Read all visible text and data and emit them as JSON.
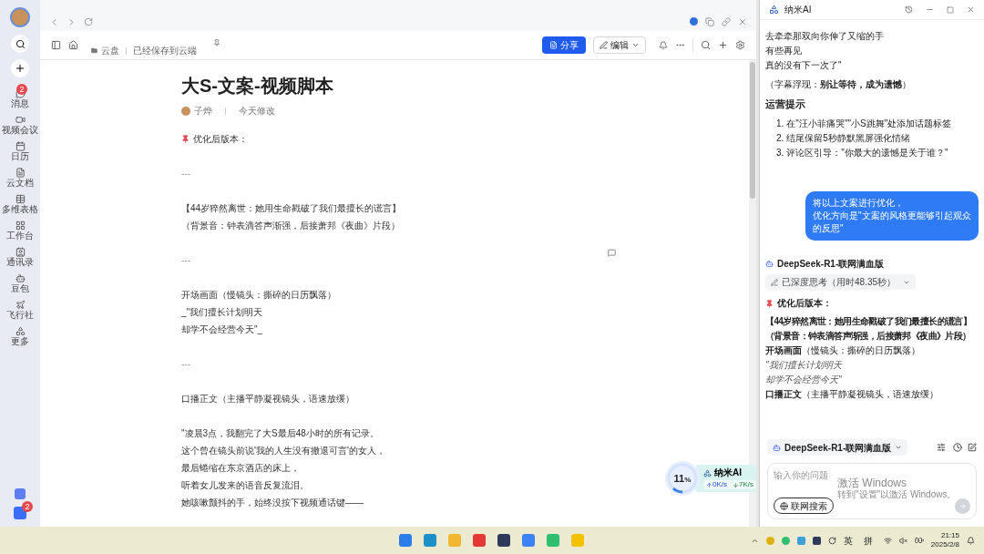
{
  "sidebar": {
    "items": [
      {
        "label": "消息",
        "badge": "2"
      },
      {
        "label": "视频会议"
      },
      {
        "label": "日历"
      },
      {
        "label": "云文档"
      },
      {
        "label": "多维表格"
      },
      {
        "label": "工作台"
      },
      {
        "label": "通讯录"
      },
      {
        "label": "豆包"
      },
      {
        "label": "飞行社"
      },
      {
        "label": "更多"
      }
    ],
    "bottom_badge": "2"
  },
  "toolbar": {
    "location": "云盘",
    "save_status": "已经保存到云端",
    "share_button": "分享",
    "edit_button": "编辑"
  },
  "document": {
    "title": "大S-文案-视频脚本",
    "author": "子烨",
    "modified": "今天修改",
    "blocks": [
      {
        "kind": "pin",
        "lines": [
          "优化后版本："
        ]
      },
      {
        "kind": "rule",
        "lines": [
          "---"
        ]
      },
      {
        "kind": "text",
        "lines": [
          "【44岁猝然离世：她用生命戳破了我们最擅长的谎言】",
          "（背景音：钟表滴答声渐强，后接萧邦《夜曲》片段）"
        ]
      },
      {
        "kind": "rule",
        "lines": [
          "---"
        ]
      },
      {
        "kind": "text",
        "lines": [
          "开场画面（慢镜头：撕碎的日历飘落）",
          "_\"我们擅长计划明天",
          "却学不会经营今天\"_"
        ]
      },
      {
        "kind": "rule",
        "lines": [
          "---"
        ]
      },
      {
        "kind": "text",
        "lines": [
          "口播正文（主播平静凝视镜头，语速放缓）"
        ]
      },
      {
        "kind": "text",
        "lines": [
          "\"凌晨3点，我翻完了大S最后48小时的所有记录。",
          "这个曾在镜头前说'我的人生没有撤退可言'的女人，",
          "最后蜷缩在东京酒店的床上，",
          "听着女儿发来的语音反复流泪。",
          "她咳嗽颤抖的手，始终没按下视频通话键——"
        ]
      }
    ]
  },
  "widget": {
    "percent": "11",
    "unit": "%",
    "name": "纳米AI",
    "upload": "0K/s",
    "download": "7K/s"
  },
  "assistant": {
    "title": "纳米AI",
    "messages": [
      {
        "kind": "ai",
        "blocks": [
          {
            "kind": "line",
            "text": "去牵牵那双向你伸了又缩的手"
          },
          {
            "kind": "line",
            "text": "有些再见"
          },
          {
            "kind": "line",
            "text": "真的没有下一次了\""
          },
          {
            "kind": "note",
            "text": "（字幕浮现：**别让等待，成为遗憾**）"
          },
          {
            "kind": "heading",
            "text": "运营提示"
          },
          {
            "kind": "ordered",
            "items": [
              {
                "number": "1.",
                "text": "在\"汪小菲痛哭\"\"小S跳舞\"处添加话题标签"
              },
              {
                "number": "2.",
                "text": "结尾保留5秒静默黑屏强化情绪"
              },
              {
                "number": "3.",
                "text": "评论区引导：\"你最大的遗憾是关于谁？\""
              }
            ]
          }
        ]
      },
      {
        "kind": "user",
        "lines": [
          "将以上文案进行优化，",
          "优化方向是\"文案的风格更能够引起观众的反思\""
        ]
      },
      {
        "kind": "ai",
        "model": "DeepSeek-R1-联网满血版",
        "thinking": "已深度思考（用时48.35秒）",
        "blocks": [
          {
            "kind": "pin",
            "text": "优化后版本："
          },
          {
            "kind": "bold",
            "text": "【44岁猝然离世：她用生命戳破了我们最擅长的谎言】"
          },
          {
            "kind": "bold",
            "text": "（背景音：钟表滴答声渐强，后接萧邦《夜曲》片段）"
          },
          {
            "kind": "line",
            "text": "**开场画面**（慢镜头：撕碎的日历飘落）"
          },
          {
            "kind": "italic",
            "text": "\"我们擅长计划明天"
          },
          {
            "kind": "italic",
            "text": "却学不会经营今天\""
          },
          {
            "kind": "line",
            "text": "**口播正文**（主播平静凝视镜头，语速放缓）"
          }
        ]
      }
    ],
    "model_selector": "DeepSeek-R1-联网满血版",
    "input": {
      "placeholder": "输入你的问题"
    },
    "web_search_button": "联网搜索"
  },
  "windows_notice": {
    "title": "激活 Windows",
    "text": "转到\"设置\"以激活 Windows。"
  },
  "taskbar": {
    "ime_language": "英",
    "ime_mode": "拼",
    "time": "21:15",
    "date": "2025/2/8"
  }
}
